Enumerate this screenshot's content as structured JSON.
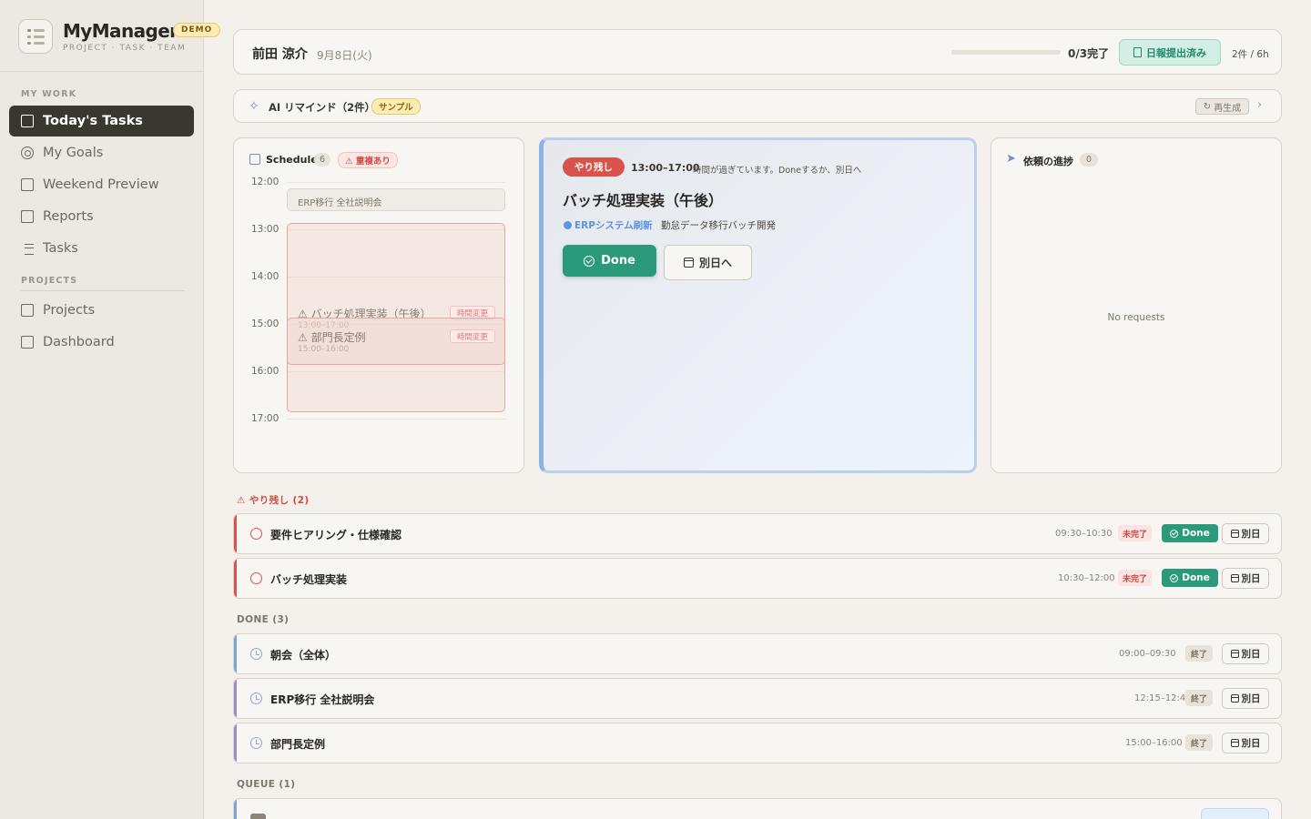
{
  "brand": {
    "name": "MyManager",
    "badge": "DEMO",
    "tagline": "PROJECT · TASK · TEAM"
  },
  "sidebar": {
    "section_work": "MY WORK",
    "section_projects": "PROJECTS",
    "items": [
      {
        "label": "Today's Tasks",
        "icon": "document-icon",
        "active": true
      },
      {
        "label": "My Goals",
        "icon": "target-icon"
      },
      {
        "label": "Weekend Preview",
        "icon": "calendar-icon"
      },
      {
        "label": "Reports",
        "icon": "report-icon"
      },
      {
        "label": "Tasks",
        "icon": "list-icon"
      }
    ],
    "project_items": [
      {
        "label": "Projects",
        "icon": "folder-icon"
      },
      {
        "label": "Dashboard",
        "icon": "grid-icon"
      }
    ]
  },
  "header": {
    "user_name": "前田 涼介",
    "date": "9月8日(火)",
    "progress_fraction": 0,
    "progress_text": "0/3完了",
    "report_label": "日報提出済み",
    "hours": "2件 / 6h"
  },
  "ai_remind": {
    "title": "AI リマインド（2件）",
    "badge": "サンプル",
    "regenerate_label": "再生成"
  },
  "schedule": {
    "title": "Schedule",
    "count": "6",
    "overlap_label": "重複あり",
    "hours": [
      "12:00",
      "13:00",
      "14:00",
      "15:00",
      "16:00",
      "17:00"
    ],
    "events": [
      {
        "name": "ERP移行 全社説明会"
      },
      {
        "name": "バッチ処理実装（午後）",
        "time": "13:00–17:00",
        "tag": "時間変更"
      },
      {
        "name": "部門長定例",
        "time": "15:00–16:00",
        "tag": "時間変更"
      }
    ]
  },
  "current_task": {
    "badge": "やり残し",
    "time": "13:00–17:00",
    "note": "時間が過ぎています。Doneするか、別日へ",
    "title": "バッチ処理実装（午後）",
    "project": "ERPシステム刷新",
    "subtitle": "勤怠データ移行バッチ開発",
    "done_label": "Done",
    "later_label": "別日へ",
    "accent_color": "#5a95e0"
  },
  "requests": {
    "title": "依頼の進捗",
    "count": "0",
    "empty_text": "No requests"
  },
  "sections": {
    "leftover": "やり残し (2)",
    "done": "DONE (3)",
    "queue": "QUEUE (1)"
  },
  "leftover_tasks": [
    {
      "title": "要件ヒアリング・仕様確認",
      "time": "09:30–10:30",
      "status": "未完了",
      "done_label": "Done",
      "later_label": "別日"
    },
    {
      "title": "バッチ処理実装",
      "time": "10:30–12:00",
      "status": "未完了",
      "done_label": "Done",
      "later_label": "別日"
    }
  ],
  "done_tasks": [
    {
      "title": "朝会（全体）",
      "time": "09:00–09:30",
      "status": "終了",
      "later_label": "別日"
    },
    {
      "title": "ERP移行 全社説明会",
      "time": "12:15–12:45",
      "status": "終了",
      "later_label": "別日"
    },
    {
      "title": "部門長定例",
      "time": "15:00–16:00",
      "status": "終了",
      "later_label": "別日"
    }
  ],
  "colors": {
    "accent_green": "#2a9a7b",
    "alert_red": "#d9534c",
    "sidebar_active": "#3a3630",
    "blue_accent": "#5a95e0"
  }
}
